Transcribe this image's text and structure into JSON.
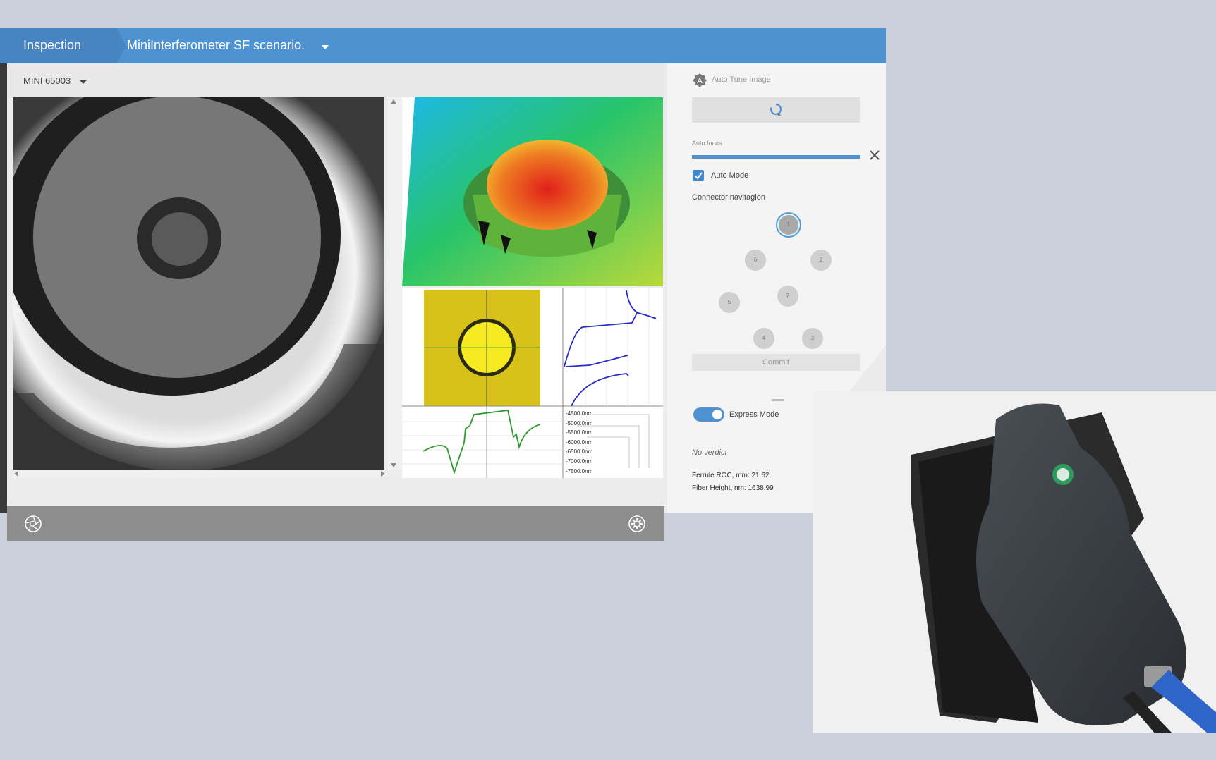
{
  "titlebar": {
    "tab_label": "Inspection",
    "scenario_label": "MiniInterferometer SF scenario."
  },
  "device": {
    "label": "MINI 65003"
  },
  "side_panel": {
    "auto_tune_label": "Auto Tune Image",
    "auto_focus_label": "Auto focus",
    "auto_focus_progress": 1.0,
    "auto_mode_label": "Auto Mode",
    "auto_mode_checked": true,
    "connector_nav_title": "Connector navitagion",
    "connectors": [
      "1",
      "2",
      "3",
      "4",
      "5",
      "6",
      "7"
    ],
    "selected_connector": "1",
    "commit_label": "Commit",
    "express_mode_label": "Express Mode",
    "express_mode_on": true,
    "verdict": "No verdict",
    "measurements": [
      {
        "label": "Ferrule ROC, mm:",
        "value": "21.62"
      },
      {
        "label": "Fiber Height, nm:",
        "value": "1638.99"
      }
    ]
  },
  "plot_axis": {
    "ticks": [
      "-4500.0nm",
      "-5000.0nm",
      "-5500.0nm",
      "-6000.0nm",
      "-6500.0nm",
      "-7000.0nm",
      "-7500.0nm"
    ]
  },
  "icons": {
    "capture": "aperture-icon",
    "settings": "gear-icon",
    "auto_tune": "auto-tune-icon",
    "close": "close-icon"
  },
  "colors": {
    "accent": "#4e92d2",
    "titlebar": "#4e92d2",
    "profile_green": "#2e9a2e",
    "profile_blue": "#2a2ac8"
  }
}
